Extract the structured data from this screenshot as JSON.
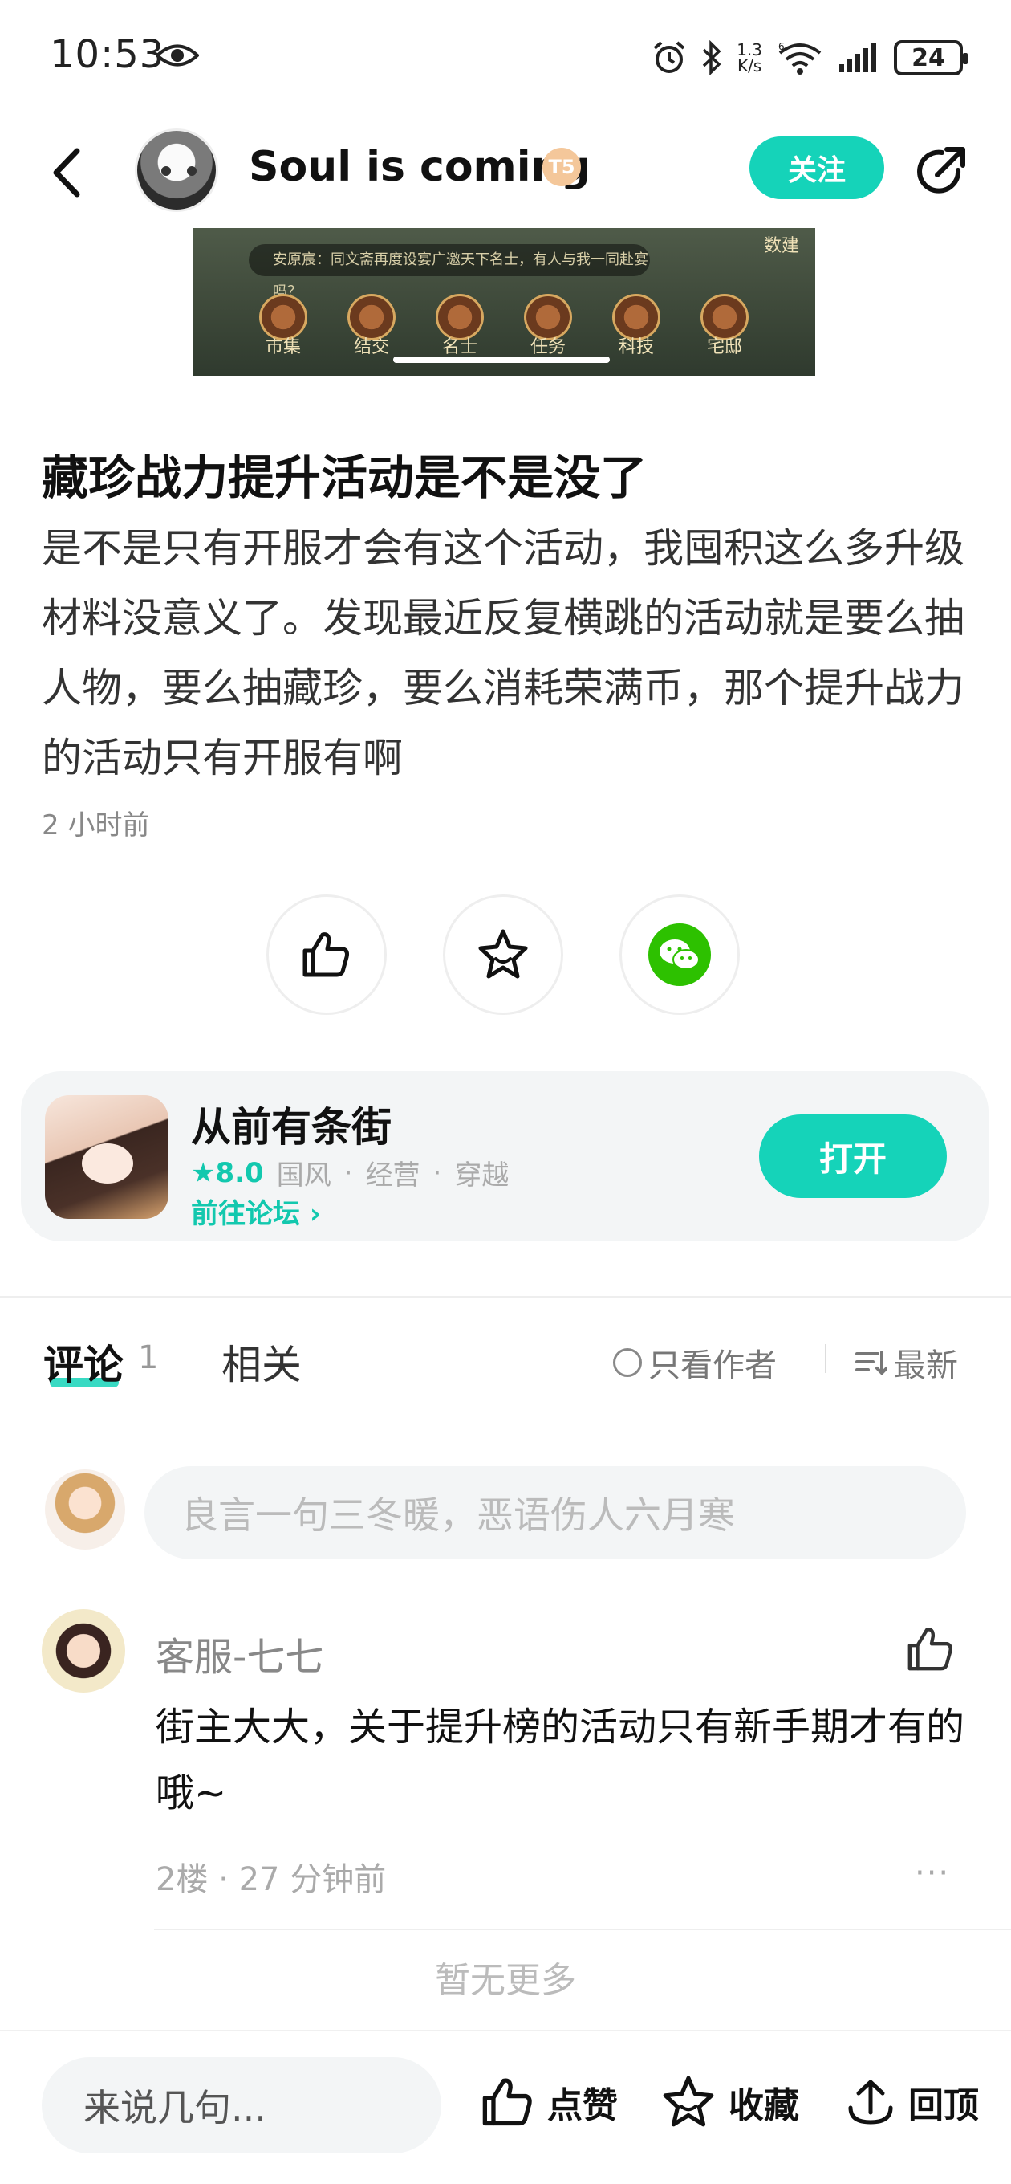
{
  "status_bar": {
    "time": "10:53",
    "net_speed_value": "1.3",
    "net_speed_unit": "K/s",
    "wifi_tag": "6",
    "battery": "24"
  },
  "header": {
    "username": "Soul is coming",
    "level_badge": "T5",
    "follow_label": "关注"
  },
  "banner": {
    "message": "安原宸：同文斋再度设宴广邀天下名士，有人与我一同赴宴吗？",
    "icons": [
      "市集",
      "结交",
      "名士",
      "任务",
      "科技",
      "宅邸"
    ],
    "tag": "数建"
  },
  "post": {
    "title": "藏珍战力提升活动是不是没了",
    "body": "是不是只有开服才会有这个活动，我囤积这么多升级材料没意义了。发现最近反复横跳的活动就是要么抽人物，要么抽藏珍，要么消耗荣满币，那个提升战力的活动只有开服有啊",
    "time": "2 小时前"
  },
  "game": {
    "name": "从前有条街",
    "rating": "★8.0",
    "tags": [
      "国风",
      "经营",
      "穿越"
    ],
    "tag_sep": "·",
    "forum_link": "前往论坛 ›",
    "open_label": "打开"
  },
  "tabs": {
    "comments": "评论",
    "comments_count": "1",
    "related": "相关",
    "author_only": "只看作者",
    "sort": "最新"
  },
  "comment_input": {
    "placeholder": "良言一句三冬暖，恶语伤人六月寒"
  },
  "comments": [
    {
      "name": "客服-七七",
      "text": "街主大大，关于提升榜的活动只有新手期才有的哦~",
      "meta": "2楼 · 27 分钟前",
      "more": "···"
    }
  ],
  "no_more": "暂无更多",
  "bottom_bar": {
    "reply_placeholder": "来说几句...",
    "like": "点赞",
    "favorite": "收藏",
    "top": "回顶"
  },
  "colors": {
    "accent": "#15d3b9",
    "wechat": "#2dc100"
  }
}
